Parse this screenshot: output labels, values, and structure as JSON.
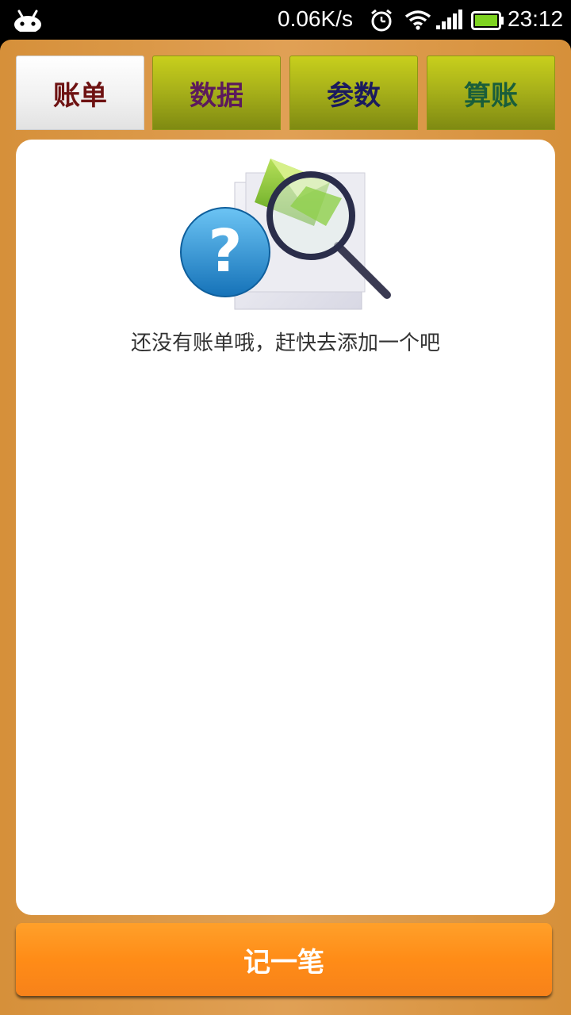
{
  "status_bar": {
    "net_speed": "0.06K/s",
    "time": "23:12",
    "icons": [
      "android-icon",
      "alarm-clock-icon",
      "wifi-icon",
      "signal-icon",
      "battery-icon"
    ],
    "battery_color": "#7ed321"
  },
  "tabs": [
    {
      "label": "账单",
      "active": true,
      "color": "#6e1212"
    },
    {
      "label": "数据",
      "active": false,
      "color": "#5c1a5c"
    },
    {
      "label": "参数",
      "active": false,
      "color": "#1a1a5e"
    },
    {
      "label": "算账",
      "active": false,
      "color": "#1a5e3a"
    }
  ],
  "empty_state": {
    "icon": "search-mail-help-icon",
    "message": "还没有账单哦，赶快去添加一个吧"
  },
  "add_button": {
    "label": "记一笔"
  },
  "colors": {
    "frame": "#dd9a48",
    "button": "#ff8c17",
    "tab_inactive": "#a9b21a"
  }
}
